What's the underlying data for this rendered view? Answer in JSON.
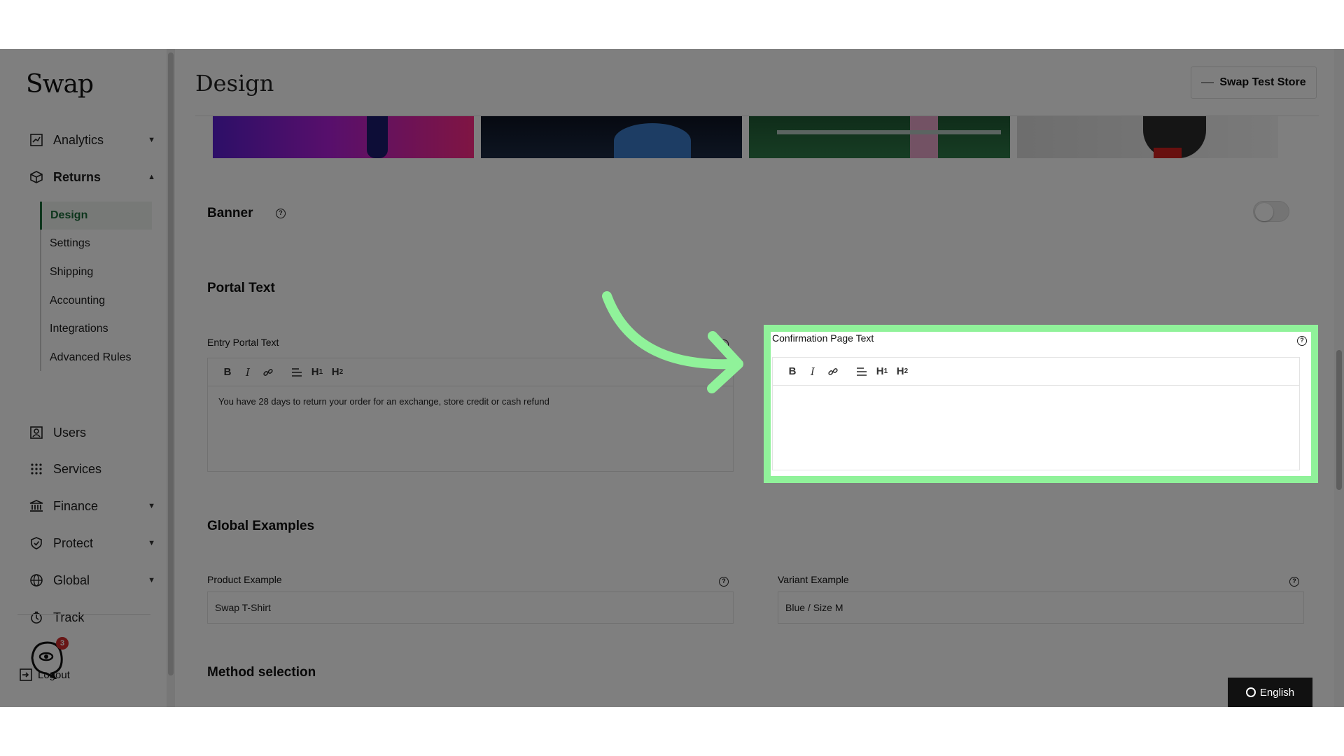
{
  "app": {
    "name": "Swap"
  },
  "sidebar": {
    "items": [
      {
        "label": "Analytics",
        "icon": "chart-icon",
        "expandable": true
      },
      {
        "label": "Returns",
        "icon": "box-icon",
        "expandable": true,
        "expanded": true
      },
      {
        "label": "Users",
        "icon": "user-icon",
        "expandable": false
      },
      {
        "label": "Services",
        "icon": "grid-icon",
        "expandable": false
      },
      {
        "label": "Finance",
        "icon": "bank-icon",
        "expandable": true
      },
      {
        "label": "Protect",
        "icon": "shield-icon",
        "expandable": true
      },
      {
        "label": "Global",
        "icon": "globe-icon",
        "expandable": true
      },
      {
        "label": "Track",
        "icon": "track-icon",
        "expandable": false
      }
    ],
    "returns_sub": [
      "Design",
      "Settings",
      "Shipping",
      "Accounting",
      "Integrations",
      "Advanced Rules"
    ],
    "active_sub": "Design",
    "badge_count": "3",
    "logout_label": "Logout"
  },
  "header": {
    "title": "Design",
    "store_label": "Swap Test Store"
  },
  "sections": {
    "banner": {
      "title": "Banner",
      "enabled": false
    },
    "portal_text": {
      "title": "Portal Text",
      "entry_label": "Entry Portal Text",
      "entry_value": "You have 28 days to return your order for an exchange, store credit or cash refund",
      "confirmation_label": "Confirmation Page Text",
      "confirmation_value": ""
    },
    "global_examples": {
      "title": "Global Examples",
      "product_label": "Product Example",
      "product_value": "Swap T-Shirt",
      "variant_label": "Variant Example",
      "variant_value": "Blue / Size M"
    },
    "method_selection": {
      "title": "Method selection"
    }
  },
  "toolbar": {
    "bold": "B",
    "italic": "I",
    "h1": "H1",
    "h2": "H2"
  },
  "language": {
    "label": "English"
  },
  "colors": {
    "accent": "#1a6b39",
    "highlight": "#90f29a",
    "badge": "#d12c2c"
  }
}
